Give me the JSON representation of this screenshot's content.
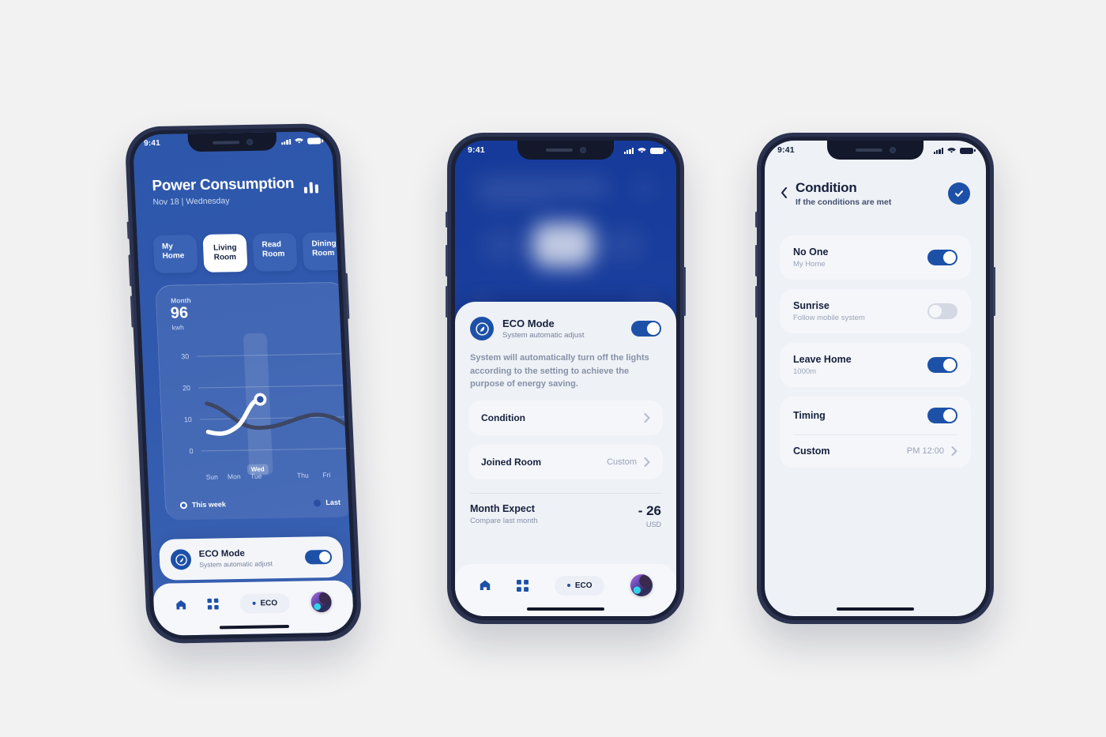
{
  "theme": {
    "bg": "#f2f2f2",
    "brand_blue": "#1d51a8",
    "screen_blue": "#2d57ab",
    "panel": "#eef1f6",
    "ink": "#16203c",
    "muted": "#8791a8"
  },
  "phone1": {
    "status": {
      "time": "9:41",
      "signal_icon": "cellular-bars-icon",
      "wifi_icon": "wifi-icon",
      "battery_icon": "battery-icon"
    },
    "header": {
      "title": "Power Consumption",
      "subtitle": "Nov 18 | Wednesday",
      "chart_icon": "bar-chart-icon"
    },
    "tabs": [
      {
        "line1": "My",
        "line2": "Home",
        "active": false
      },
      {
        "line1": "Living",
        "line2": "Room",
        "active": true
      },
      {
        "line1": "Read",
        "line2": "Room",
        "active": false
      },
      {
        "line1": "Dining",
        "line2": "Room",
        "active": false
      }
    ],
    "summary": {
      "period": "Month",
      "value": "96",
      "unit": "kwh"
    },
    "highlight_label": "Wed",
    "legend": {
      "this_week": "This week",
      "last_week": "Last"
    },
    "eco": {
      "title": "ECO Mode",
      "subtitle": "System automatic adjust",
      "icon": "leaf-icon",
      "toggle_on": true
    },
    "nav": {
      "home_icon": "home-icon",
      "grid_icon": "grid-icon",
      "eco_label": "ECO",
      "avatar": "user-avatar"
    }
  },
  "chart_data": {
    "type": "line",
    "title": "Power Consumption",
    "subtitle": "Month 96 kwh",
    "categories": [
      "Sun",
      "Mon",
      "Tue",
      "Wed",
      "Thu",
      "Fri"
    ],
    "series": [
      {
        "name": "This week",
        "color": "#ffffff",
        "values": [
          7,
          8,
          11,
          16,
          null,
          null
        ]
      },
      {
        "name": "Last week",
        "color": "#3d4663",
        "values": [
          15,
          12,
          10,
          9,
          10,
          13
        ]
      }
    ],
    "yticks": [
      0,
      10,
      20,
      30
    ],
    "ylim": [
      0,
      33
    ],
    "ylabel": "kwh",
    "xlabel": "",
    "grid": true,
    "legend_position": "bottom",
    "highlight": {
      "category": "Wed",
      "value": 16,
      "label": "Wed"
    }
  },
  "phone2": {
    "status": {
      "time": "9:41",
      "signal_icon": "cellular-bars-icon",
      "wifi_icon": "wifi-icon",
      "battery_icon": "battery-icon"
    },
    "eco": {
      "title": "ECO Mode",
      "subtitle": "System automatic adjust",
      "icon": "leaf-icon",
      "toggle_on": true
    },
    "description": "System will automatically turn off the lights according to the setting to achieve the purpose of energy saving.",
    "rows": [
      {
        "label": "Condition",
        "value": "",
        "chevron": "chevron-right-icon"
      },
      {
        "label": "Joined Room",
        "value": "Custom",
        "chevron": "chevron-right-icon"
      }
    ],
    "expect": {
      "title": "Month Expect",
      "subtitle": "Compare last month",
      "value": "- 26",
      "unit": "USD"
    },
    "nav": {
      "home_icon": "home-icon",
      "grid_icon": "grid-icon",
      "eco_label": "ECO",
      "avatar": "user-avatar"
    }
  },
  "phone3": {
    "status": {
      "time": "9:41",
      "signal_icon": "cellular-bars-icon",
      "wifi_icon": "wifi-icon",
      "battery_icon": "battery-icon"
    },
    "header": {
      "back_icon": "chevron-left-icon",
      "title": "Condition",
      "subtitle": "If the conditions are met",
      "confirm_icon": "check-circle-icon"
    },
    "items": [
      {
        "label": "No One",
        "sub": "My Home",
        "toggle_on": true
      },
      {
        "label": "Sunrise",
        "sub": "Follow mobile system",
        "toggle_on": false
      },
      {
        "label": "Leave Home",
        "sub": "1000m",
        "toggle_on": true
      }
    ],
    "timing": {
      "label": "Timing",
      "toggle_on": true,
      "custom_label": "Custom",
      "custom_value": "PM 12:00",
      "chevron": "chevron-right-icon"
    }
  }
}
